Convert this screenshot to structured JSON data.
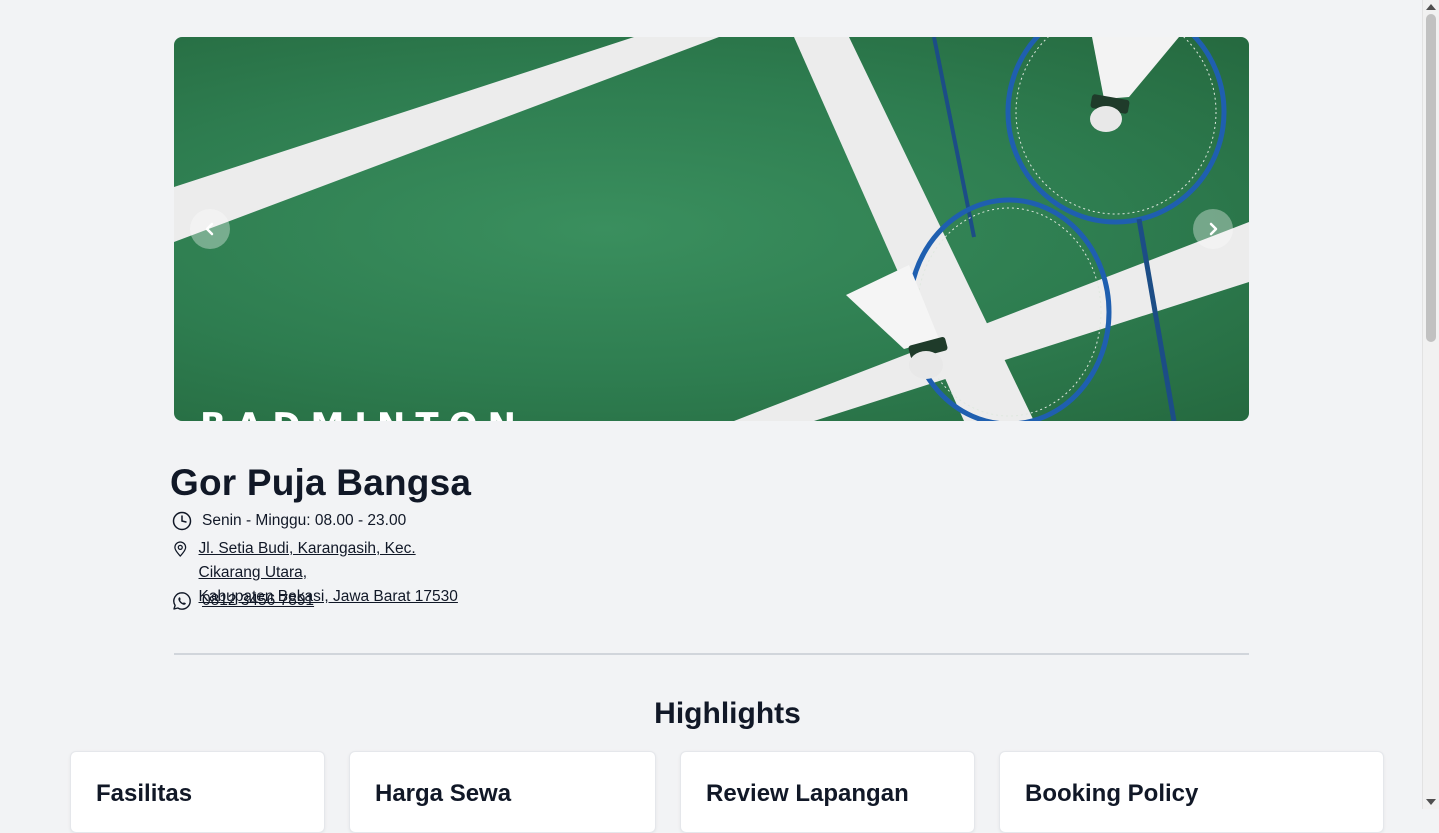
{
  "carousel": {
    "prev_icon": "chevron-left-icon",
    "next_icon": "chevron-right-icon",
    "image_caption_text": "BADMINTON",
    "court_color": "#2e7d50"
  },
  "venue": {
    "name": "Gor Puja Bangsa",
    "hours": "Senin - Minggu: 08.00 - 23.00",
    "address_line1": "Jl. Setia Budi, Karangasih, Kec. Cikarang Utara,",
    "address_line2": "Kabupaten Bekasi, Jawa Barat 17530",
    "phone": "0812 3456 7891",
    "icons": [
      "clock-icon",
      "map-pin-icon",
      "whatsapp-icon"
    ]
  },
  "highlights": {
    "title": "Highlights",
    "cards": [
      {
        "title": "Fasilitas"
      },
      {
        "title": "Harga Sewa"
      },
      {
        "title": "Review Lapangan"
      },
      {
        "title": "Booking Policy"
      }
    ]
  },
  "colors": {
    "page_background": "#f2f3f5",
    "text": "#111827",
    "divider": "#d1d5db"
  }
}
